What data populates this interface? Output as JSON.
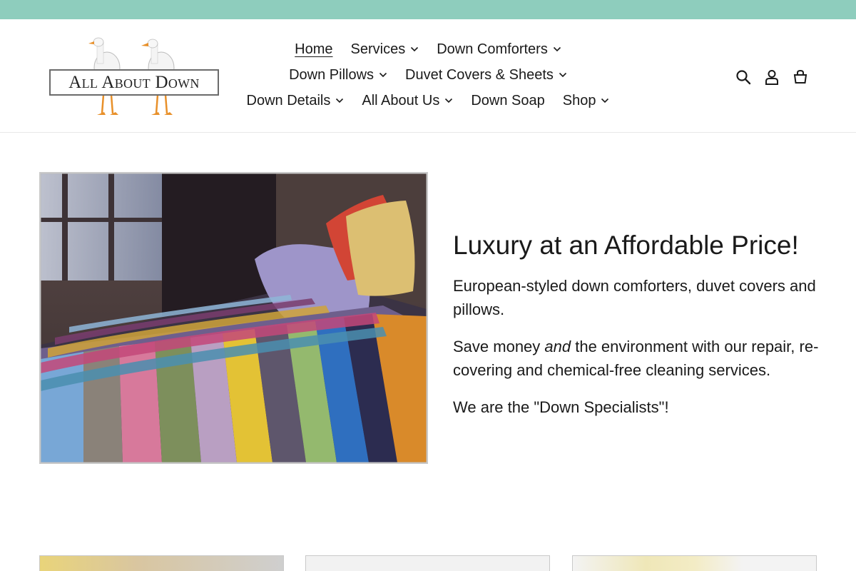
{
  "announcement": {
    "color": "#8ecdbd"
  },
  "logo": {
    "text": "All About Down",
    "alt": "All About Down"
  },
  "nav": {
    "row1": [
      {
        "label": "Home",
        "dropdown": false,
        "active": true
      },
      {
        "label": "Services",
        "dropdown": true
      },
      {
        "label": "Down Comforters",
        "dropdown": true
      }
    ],
    "row2": [
      {
        "label": "Down Pillows",
        "dropdown": true
      },
      {
        "label": "Duvet Covers & Sheets",
        "dropdown": true
      }
    ],
    "row3": [
      {
        "label": "Down Details",
        "dropdown": true
      },
      {
        "label": "All About Us",
        "dropdown": true
      },
      {
        "label": "Down Soap",
        "dropdown": false
      },
      {
        "label": "Shop",
        "dropdown": true
      }
    ]
  },
  "header_icons": [
    "search-icon",
    "user-icon",
    "cart-icon"
  ],
  "hero": {
    "title": "Luxury at an Affordable Price!",
    "p1": "European-styled down comforters, duvet covers and pillows.",
    "p2_before": "Save money ",
    "p2_em": "and",
    "p2_after": " the environment with our repair, re-covering and chemical-free cleaning services.",
    "p3": "We are the \"Down Specialists\"!"
  }
}
